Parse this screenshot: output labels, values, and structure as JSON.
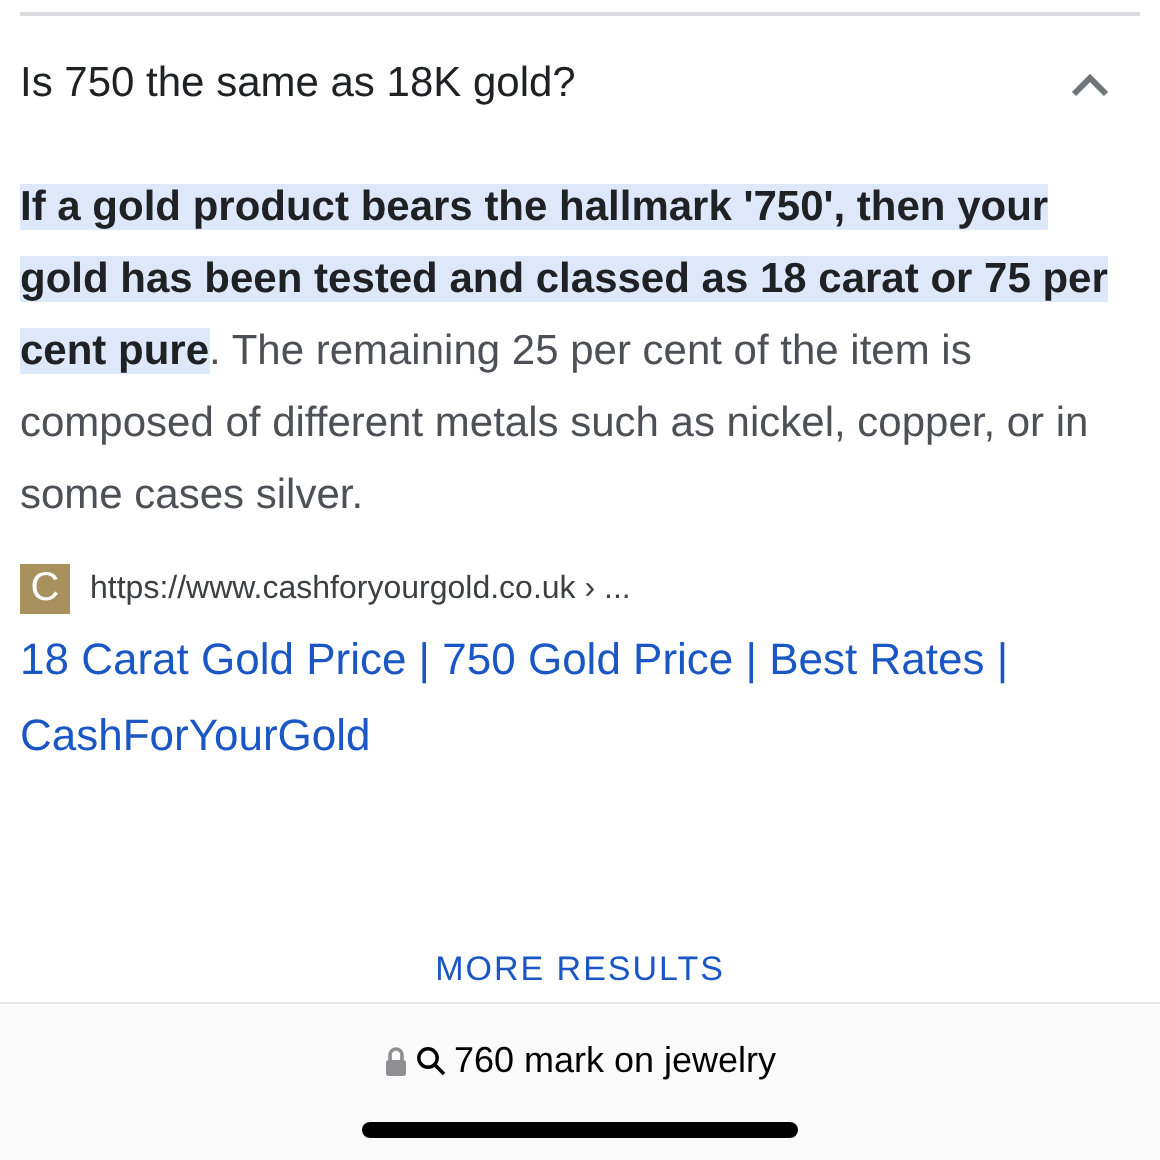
{
  "question": {
    "text": "Is 750 the same as 18K gold?",
    "expanded": true
  },
  "answer": "**If a gold product bears the hallmark '750', then your gold has been tested and classed as 18 carat or 75 per cent pure**. The remaining 25 per cent of the item is composed of different metals such as nickel, copper, or in some cases silver.",
  "source": {
    "favicon": "C",
    "url": "https://www.cashforyourgold.co.uk › ..."
  },
  "result_title": "18 Carat Gold Price | 750 Gold Price | Best Rates | CashForYourGold",
  "more_results": "MORE RESULTS",
  "address_bar": {
    "query": "760 mark on jewelry"
  }
}
